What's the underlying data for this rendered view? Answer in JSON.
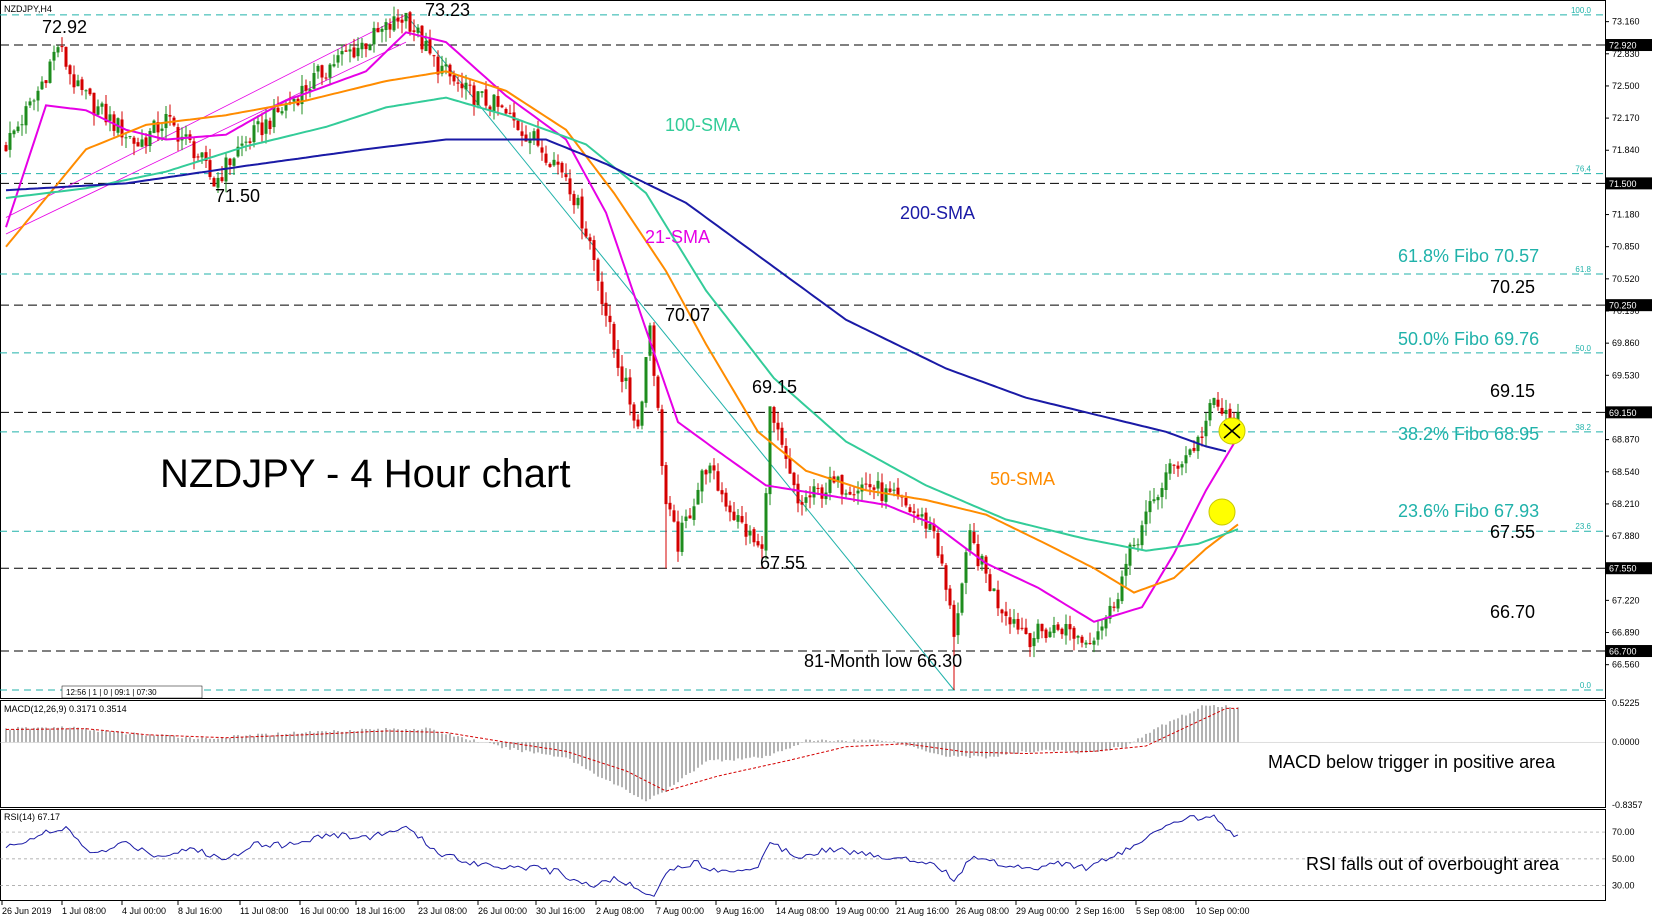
{
  "header": {
    "symbol": "NZDJPY,H4",
    "title": "NZDJPY - 4 Hour chart",
    "mini_toolbar": "12:56 | 1 | 0 | 09:1 | 07:30"
  },
  "colors": {
    "candle_up": "#1e8c1e",
    "candle_down": "#d40000",
    "sma21": "#e600e6",
    "sma50": "#ff8c00",
    "sma100": "#33cc99",
    "sma200": "#1a1aa6",
    "fibo": "#20b2aa",
    "macd_hist": "#a0a0a0",
    "macd_signal": "#d40000",
    "rsi": "#1a1aa6",
    "highlight": "#ffff00"
  },
  "chart_data": [
    {
      "type": "candlestick",
      "title": "NZDJPY - 4 Hour chart",
      "symbol": "NZDJPY,H4",
      "ylim": [
        66.3,
        73.3
      ],
      "x_ticks": [
        "26 Jun 2019",
        "1 Jul 08:00",
        "4 Jul 00:00",
        "8 Jul 16:00",
        "11 Jul 08:00",
        "16 Jul 00:00",
        "18 Jul 16:00",
        "23 Jul 08:00",
        "26 Jul 00:00",
        "30 Jul 16:00",
        "2 Aug 08:00",
        "7 Aug 00:00",
        "9 Aug 16:00",
        "14 Aug 08:00",
        "19 Aug 00:00",
        "21 Aug 16:00",
        "26 Aug 08:00",
        "29 Aug 00:00",
        "2 Sep 16:00",
        "5 Sep 08:00",
        "10 Sep 00:00"
      ],
      "y_ticks": [
        "73.160",
        "72.830",
        "72.500",
        "72.170",
        "71.840",
        "71.510",
        "71.180",
        "70.850",
        "70.520",
        "70.190",
        "69.860",
        "69.530",
        "68.870",
        "68.540",
        "68.210",
        "67.880",
        "67.220",
        "66.890",
        "66.560"
      ],
      "price_tags": [
        "72.920",
        "71.500",
        "70.250",
        "69.150",
        "67.550",
        "66.700"
      ],
      "anchors": [
        [
          0,
          71.9
        ],
        [
          7,
          72.35
        ],
        [
          13,
          72.92
        ],
        [
          18,
          72.45
        ],
        [
          26,
          72.15
        ],
        [
          33,
          71.9
        ],
        [
          40,
          72.15
        ],
        [
          47,
          71.85
        ],
        [
          52,
          71.5
        ],
        [
          58,
          71.85
        ],
        [
          70,
          72.3
        ],
        [
          82,
          72.75
        ],
        [
          94,
          73.05
        ],
        [
          100,
          73.23
        ],
        [
          106,
          72.8
        ],
        [
          114,
          72.45
        ],
        [
          122,
          72.3
        ],
        [
          132,
          71.95
        ],
        [
          140,
          71.6
        ],
        [
          146,
          70.9
        ],
        [
          152,
          69.8
        ],
        [
          158,
          69.0
        ],
        [
          161,
          70.07
        ],
        [
          165,
          68.2
        ],
        [
          168,
          67.8
        ],
        [
          175,
          68.6
        ],
        [
          182,
          68.1
        ],
        [
          189,
          67.7
        ],
        [
          191,
          69.15
        ],
        [
          198,
          68.2
        ],
        [
          206,
          68.4
        ],
        [
          216,
          68.4
        ],
        [
          226,
          68.15
        ],
        [
          232,
          67.95
        ],
        [
          237,
          66.9
        ],
        [
          241,
          67.85
        ],
        [
          248,
          67.2
        ],
        [
          256,
          66.85
        ],
        [
          264,
          66.95
        ],
        [
          270,
          66.8
        ],
        [
          276,
          67.1
        ],
        [
          282,
          67.8
        ],
        [
          290,
          68.5
        ],
        [
          298,
          68.85
        ],
        [
          302,
          69.25
        ],
        [
          306,
          69.05
        ]
      ],
      "spikes": [
        [
          13,
          72.92,
          "hi"
        ],
        [
          100,
          73.23,
          "hi"
        ],
        [
          52,
          71.5,
          "lo"
        ],
        [
          161,
          70.07,
          "hi"
        ],
        [
          165,
          67.55,
          "lo"
        ],
        [
          191,
          69.15,
          "hi"
        ],
        [
          189,
          67.55,
          "lo"
        ],
        [
          237,
          66.3,
          "lo"
        ],
        [
          302,
          69.3,
          "hi"
        ]
      ],
      "series": [
        {
          "name": "21-SMA",
          "points": [
            [
              0,
              71.05
            ],
            [
              10,
              72.3
            ],
            [
              20,
              72.25
            ],
            [
              30,
              72.05
            ],
            [
              40,
              71.95
            ],
            [
              55,
              72.0
            ],
            [
              70,
              72.35
            ],
            [
              90,
              72.65
            ],
            [
              100,
              73.05
            ],
            [
              110,
              72.95
            ],
            [
              125,
              72.4
            ],
            [
              140,
              71.95
            ],
            [
              150,
              71.2
            ],
            [
              160,
              70.0
            ],
            [
              168,
              69.05
            ],
            [
              178,
              68.75
            ],
            [
              190,
              68.4
            ],
            [
              205,
              68.3
            ],
            [
              220,
              68.2
            ],
            [
              232,
              68.0
            ],
            [
              245,
              67.6
            ],
            [
              258,
              67.35
            ],
            [
              272,
              67.0
            ],
            [
              284,
              67.15
            ],
            [
              292,
              67.7
            ],
            [
              300,
              68.35
            ],
            [
              308,
              68.9
            ]
          ]
        },
        {
          "name": "50-SMA",
          "points": [
            [
              0,
              70.85
            ],
            [
              10,
              71.35
            ],
            [
              20,
              71.85
            ],
            [
              35,
              72.1
            ],
            [
              55,
              72.2
            ],
            [
              75,
              72.35
            ],
            [
              95,
              72.55
            ],
            [
              110,
              72.65
            ],
            [
              125,
              72.45
            ],
            [
              140,
              72.05
            ],
            [
              152,
              71.4
            ],
            [
              165,
              70.6
            ],
            [
              175,
              69.85
            ],
            [
              188,
              68.95
            ],
            [
              200,
              68.55
            ],
            [
              215,
              68.35
            ],
            [
              230,
              68.25
            ],
            [
              245,
              68.1
            ],
            [
              260,
              67.8
            ],
            [
              272,
              67.55
            ],
            [
              282,
              67.3
            ],
            [
              292,
              67.45
            ],
            [
              300,
              67.75
            ],
            [
              308,
              68.0
            ]
          ]
        },
        {
          "name": "100-SMA",
          "points": [
            [
              0,
              71.35
            ],
            [
              20,
              71.45
            ],
            [
              40,
              71.62
            ],
            [
              60,
              71.88
            ],
            [
              80,
              72.08
            ],
            [
              95,
              72.28
            ],
            [
              110,
              72.38
            ],
            [
              125,
              72.2
            ],
            [
              145,
              71.9
            ],
            [
              160,
              71.4
            ],
            [
              175,
              70.4
            ],
            [
              192,
              69.5
            ],
            [
              210,
              68.85
            ],
            [
              230,
              68.4
            ],
            [
              250,
              68.05
            ],
            [
              270,
              67.85
            ],
            [
              285,
              67.73
            ],
            [
              298,
              67.8
            ],
            [
              308,
              67.95
            ]
          ]
        },
        {
          "name": "200-SMA",
          "points": [
            [
              0,
              71.43
            ],
            [
              30,
              71.5
            ],
            [
              60,
              71.68
            ],
            [
              90,
              71.85
            ],
            [
              110,
              71.95
            ],
            [
              125,
              71.95
            ],
            [
              135,
              71.95
            ],
            [
              150,
              71.7
            ],
            [
              170,
              71.3
            ],
            [
              190,
              70.7
            ],
            [
              210,
              70.1
            ],
            [
              235,
              69.6
            ],
            [
              255,
              69.3
            ],
            [
              275,
              69.1
            ],
            [
              290,
              68.95
            ],
            [
              300,
              68.8
            ],
            [
              305,
              68.75
            ]
          ]
        }
      ],
      "levels": [
        {
          "label": "73.23",
          "value": 73.23
        },
        {
          "label": "72.92",
          "value": 72.92
        },
        {
          "label": "71.50",
          "value": 71.5
        },
        {
          "label": "70.25",
          "value": 70.25
        },
        {
          "label": "69.15",
          "value": 69.15
        },
        {
          "label": "67.55",
          "value": 67.55
        },
        {
          "label": "66.70",
          "value": 66.7
        }
      ],
      "fibo": [
        {
          "label": "61.8% Fibo 70.57",
          "value": 70.57,
          "tag": "61.8"
        },
        {
          "label": "50.0% Fibo 69.76",
          "value": 69.76,
          "tag": "50.0"
        },
        {
          "label": "38.2% Fibo 68.95",
          "value": 68.95,
          "tag": "38.2"
        },
        {
          "label": "23.6% Fibo 67.93",
          "value": 67.93,
          "tag": "23.6"
        }
      ],
      "fibo_extra": [
        {
          "value": 73.23,
          "tag": "100.0"
        },
        {
          "value": 71.6,
          "tag": "76.4"
        },
        {
          "value": 66.3,
          "tag": "0.0"
        }
      ],
      "annotations": {
        "high_7307": "70.07",
        "high_6915": "69.15",
        "low_6755": "67.55",
        "low_8130": "81-Month low 66.30",
        "sma100": "100-SMA",
        "sma200": "200-SMA",
        "sma21": "21-SMA",
        "sma50": "50-SMA",
        "low_7150": "71.50",
        "high_7292": "72.92",
        "high_7323": "73.23"
      }
    },
    {
      "type": "bar",
      "title": "MACD(12,26,9) 0.3171 0.3514",
      "ylim": [
        -0.8357,
        0.5225
      ],
      "y_ticks": [
        "0.5225",
        "0.0000",
        "-0.8357"
      ],
      "annotation": "MACD below trigger in positive area",
      "anchors": [
        [
          0,
          0.18
        ],
        [
          15,
          0.2
        ],
        [
          30,
          0.12
        ],
        [
          50,
          0.05
        ],
        [
          70,
          0.12
        ],
        [
          90,
          0.17
        ],
        [
          105,
          0.18
        ],
        [
          115,
          0.05
        ],
        [
          125,
          -0.08
        ],
        [
          140,
          -0.2
        ],
        [
          150,
          -0.5
        ],
        [
          160,
          -0.78
        ],
        [
          165,
          -0.65
        ],
        [
          175,
          -0.25
        ],
        [
          190,
          -0.2
        ],
        [
          200,
          0.02
        ],
        [
          220,
          0.03
        ],
        [
          235,
          -0.18
        ],
        [
          245,
          -0.2
        ],
        [
          260,
          -0.1
        ],
        [
          270,
          -0.15
        ],
        [
          280,
          -0.05
        ],
        [
          290,
          0.25
        ],
        [
          300,
          0.5
        ],
        [
          305,
          0.48
        ],
        [
          308,
          0.45
        ]
      ],
      "signal": [
        [
          0,
          0.17
        ],
        [
          20,
          0.18
        ],
        [
          35,
          0.1
        ],
        [
          55,
          0.06
        ],
        [
          75,
          0.1
        ],
        [
          95,
          0.15
        ],
        [
          110,
          0.13
        ],
        [
          125,
          0.0
        ],
        [
          140,
          -0.12
        ],
        [
          155,
          -0.38
        ],
        [
          165,
          -0.65
        ],
        [
          178,
          -0.45
        ],
        [
          195,
          -0.25
        ],
        [
          210,
          -0.06
        ],
        [
          225,
          -0.02
        ],
        [
          240,
          -0.13
        ],
        [
          255,
          -0.15
        ],
        [
          272,
          -0.12
        ],
        [
          285,
          -0.05
        ],
        [
          295,
          0.2
        ],
        [
          305,
          0.45
        ],
        [
          308,
          0.45
        ]
      ]
    },
    {
      "type": "line",
      "title": "RSI(14) 67.17",
      "ylim": [
        20,
        85
      ],
      "y_ticks": [
        "70.00",
        "50.00",
        "30.00"
      ],
      "annotation": "RSI falls out of overbought area",
      "values": [
        [
          0,
          58
        ],
        [
          8,
          68
        ],
        [
          15,
          72
        ],
        [
          22,
          53
        ],
        [
          30,
          62
        ],
        [
          38,
          52
        ],
        [
          46,
          58
        ],
        [
          55,
          49
        ],
        [
          62,
          62
        ],
        [
          70,
          60
        ],
        [
          80,
          68
        ],
        [
          90,
          66
        ],
        [
          100,
          73
        ],
        [
          108,
          55
        ],
        [
          115,
          48
        ],
        [
          122,
          45
        ],
        [
          130,
          44
        ],
        [
          138,
          40
        ],
        [
          146,
          30
        ],
        [
          152,
          35
        ],
        [
          158,
          28
        ],
        [
          162,
          24
        ],
        [
          166,
          42
        ],
        [
          172,
          47
        ],
        [
          180,
          40
        ],
        [
          188,
          45
        ],
        [
          191,
          62
        ],
        [
          198,
          52
        ],
        [
          206,
          58
        ],
        [
          215,
          53
        ],
        [
          225,
          50
        ],
        [
          232,
          47
        ],
        [
          237,
          35
        ],
        [
          242,
          52
        ],
        [
          250,
          45
        ],
        [
          258,
          44
        ],
        [
          264,
          47
        ],
        [
          270,
          43
        ],
        [
          276,
          50
        ],
        [
          282,
          60
        ],
        [
          288,
          70
        ],
        [
          295,
          80
        ],
        [
          302,
          82
        ],
        [
          306,
          71
        ],
        [
          308,
          67
        ]
      ]
    }
  ]
}
